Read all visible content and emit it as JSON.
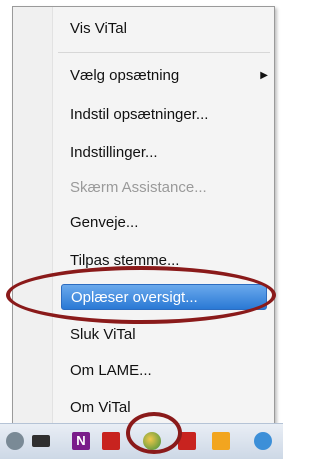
{
  "menu": {
    "items": [
      {
        "label": "Vis ViTal"
      },
      {
        "label": "Vælg opsætning",
        "submenu_icon": "chevron-right-icon"
      },
      {
        "label": "Indstil opsætninger..."
      },
      {
        "label": "Indstillinger..."
      },
      {
        "label": "Skærm Assistance...",
        "disabled": true
      },
      {
        "label": "Genveje..."
      },
      {
        "label": "Tilpas stemme..."
      },
      {
        "label": "Oplæser oversigt...",
        "highlighted": true
      },
      {
        "label": "Sluk ViTal"
      },
      {
        "label": "Om LAME..."
      },
      {
        "label": "Om ViTal"
      }
    ],
    "highlight_color": "#3b86de",
    "annotation_color": "#8a1a1a"
  },
  "taskbar": {
    "icons": [
      "speaker-icon",
      "network-icon",
      "onenote-icon",
      "pdf-icon",
      "vital-app-icon",
      "flash-icon",
      "office-icon",
      "ie-icon"
    ]
  }
}
